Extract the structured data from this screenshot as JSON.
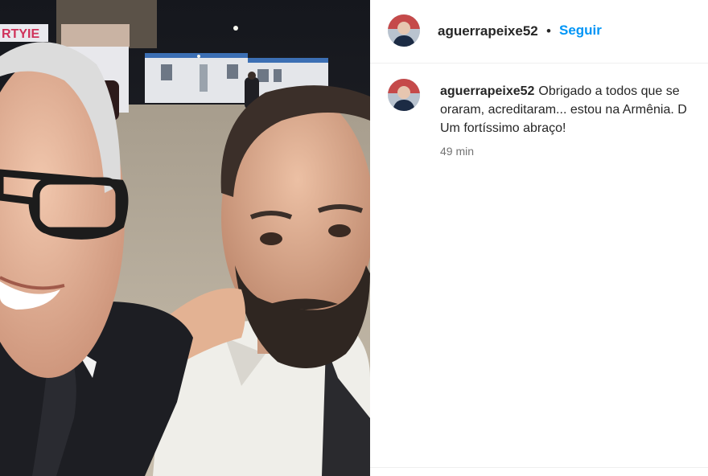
{
  "post": {
    "username": "aguerrapeixe52",
    "separator": "•",
    "follow_label": "Seguir"
  },
  "caption": {
    "username": "aguerrapeixe52",
    "line1": "Obrigado a todos que se",
    "line2": "oraram, acreditaram... estou na Armênia. D",
    "line3": "Um fortíssimo abraço!",
    "time": "49 min"
  },
  "photo": {
    "sign_text": "RTYIE"
  },
  "colors": {
    "follow": "#0095f6",
    "text": "#262626",
    "muted": "#737373"
  }
}
